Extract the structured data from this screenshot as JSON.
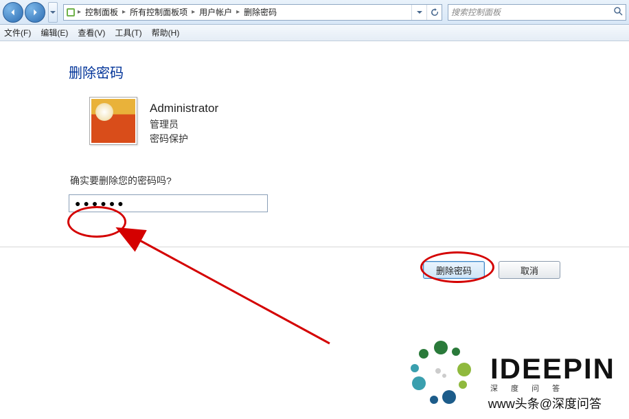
{
  "breadcrumb": {
    "root_glyph": "▸",
    "items": [
      "控制面板",
      "所有控制面板项",
      "用户帐户",
      "删除密码"
    ]
  },
  "search": {
    "placeholder": "搜索控制面板"
  },
  "menubar": [
    "文件(F)",
    "编辑(E)",
    "查看(V)",
    "工具(T)",
    "帮助(H)"
  ],
  "page": {
    "title": "删除密码",
    "user_name": "Administrator",
    "user_role": "管理员",
    "user_protect": "密码保护",
    "confirm_label": "确实要删除您的密码吗?",
    "password_value": "●●●●●●"
  },
  "actions": {
    "primary": "删除密码",
    "cancel": "取消"
  },
  "watermark": {
    "brand": "IDEEPIN",
    "tagline": "深 度 问 答",
    "attribution": "www头条@深度问答"
  }
}
